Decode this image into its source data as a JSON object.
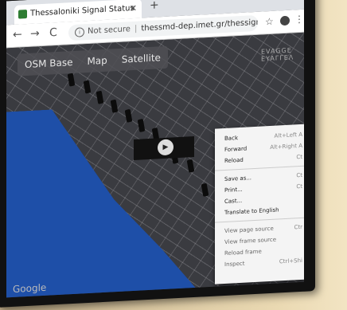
{
  "tab": {
    "title": "Thessaloniki Signal Status",
    "close": "✕",
    "new_tab": "+"
  },
  "toolbar": {
    "back": "←",
    "forward": "→",
    "reload": "C",
    "info": "i",
    "security": "Not secure",
    "separator": "|",
    "url": "thessmd-dep.imet.gr/thessignalgroupstatus/...",
    "star": "☆",
    "menu": "⋮"
  },
  "map": {
    "layers": [
      "OSM Base",
      "Map",
      "Satellite"
    ],
    "label": "EVAGGE\nEYAΓΓΕΛ",
    "attribution": "Google"
  },
  "context_menu": {
    "groups": [
      [
        {
          "label": "Back",
          "shortcut": "Alt+Left A"
        },
        {
          "label": "Forward",
          "shortcut": "Alt+Right A"
        },
        {
          "label": "Reload",
          "shortcut": "Ct"
        }
      ],
      [
        {
          "label": "Save as...",
          "shortcut": "Ct"
        },
        {
          "label": "Print...",
          "shortcut": "Ct"
        },
        {
          "label": "Cast...",
          "shortcut": ""
        },
        {
          "label": "Translate to English",
          "shortcut": ""
        }
      ],
      [
        {
          "label": "View page source",
          "shortcut": "Ctr"
        },
        {
          "label": "View frame source",
          "shortcut": ""
        },
        {
          "label": "Reload frame",
          "shortcut": ""
        },
        {
          "label": "Inspect",
          "shortcut": "Ctrl+Shi"
        }
      ]
    ]
  },
  "colors": {
    "sea": "#1e4fa8",
    "map_bg": "#3a3b40"
  }
}
